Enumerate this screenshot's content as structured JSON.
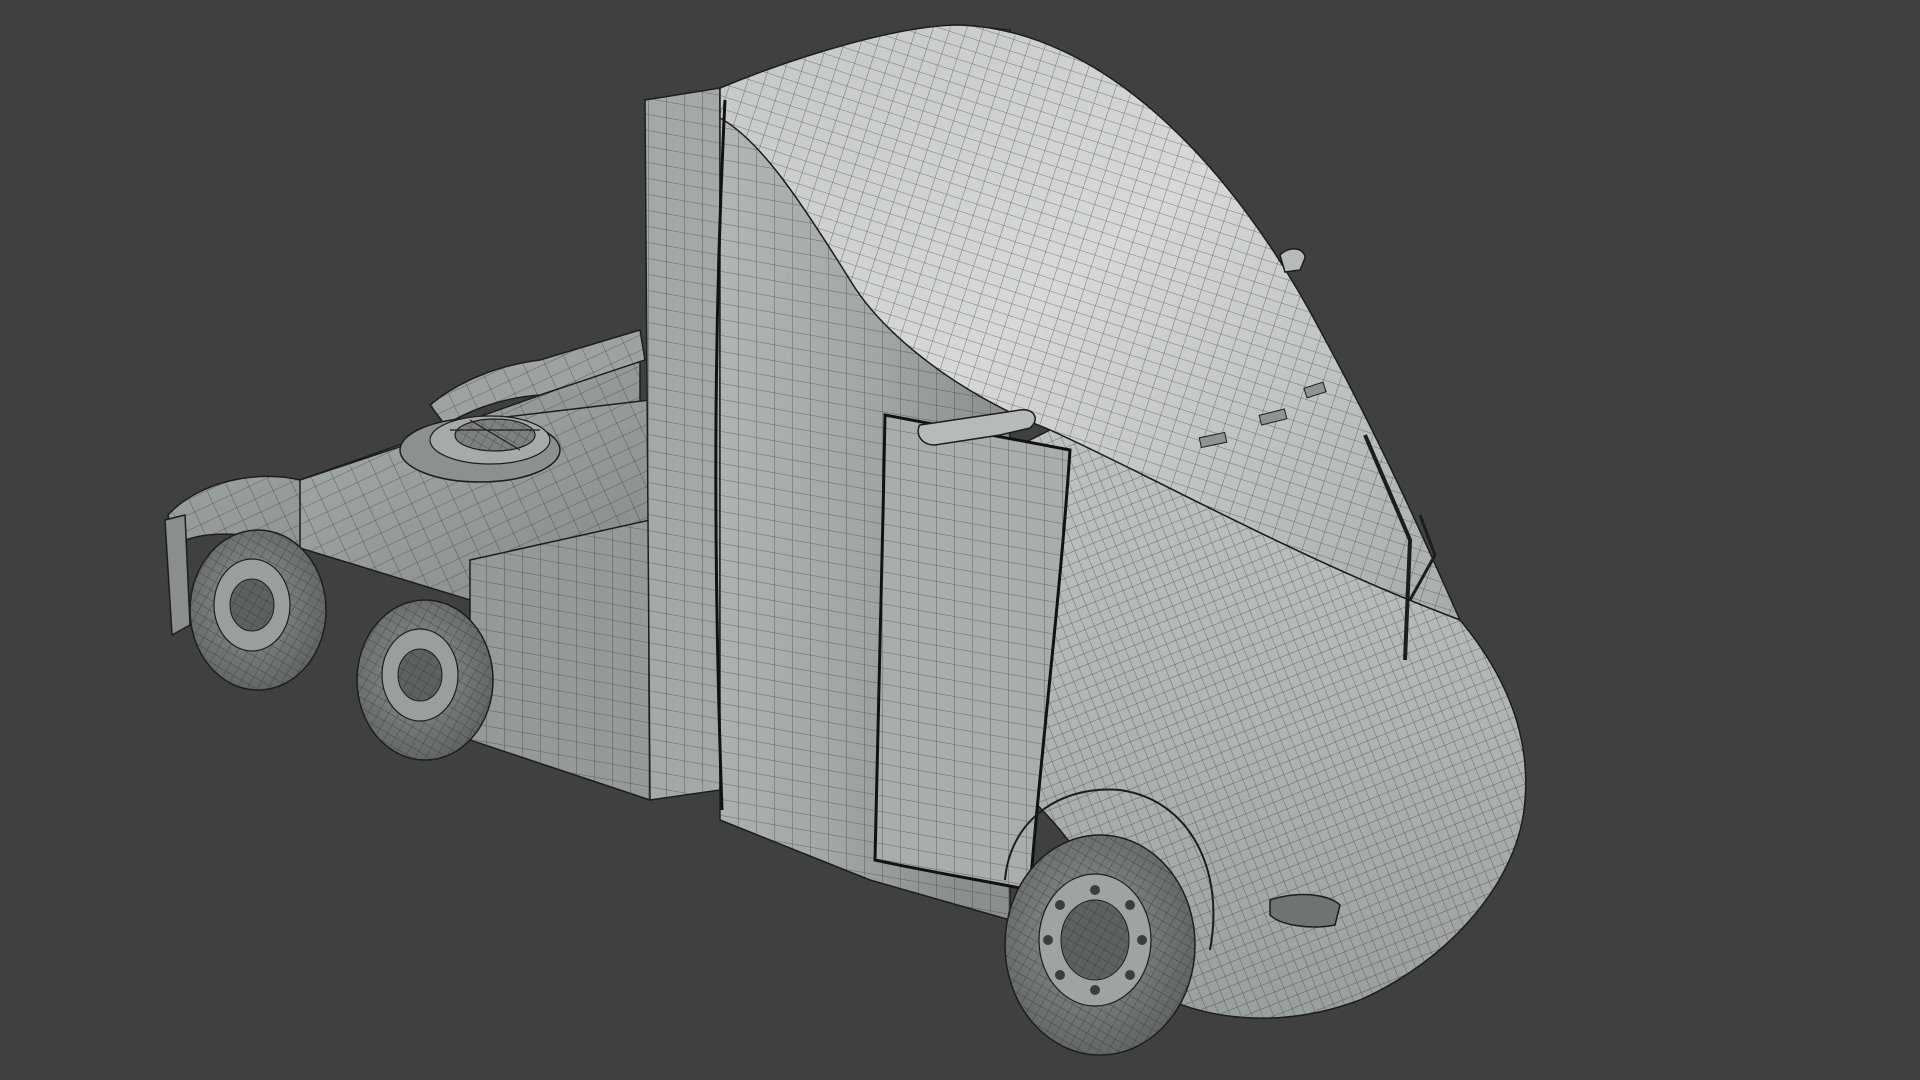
{
  "viewport": {
    "background_color": "#404040",
    "shading": "solid-matcap-gray",
    "overlay": "wireframe"
  },
  "model": {
    "subject": "semi-truck-tractor-cab",
    "surface_color": "#a9aeaa",
    "surface_highlight": "#d4d7d4",
    "surface_shadow": "#6f7572",
    "wire_color": "#2a2d2b",
    "outline_color": "#1c1e1d",
    "tire_color": "#7c807e",
    "hub_color": "#5d615f"
  }
}
